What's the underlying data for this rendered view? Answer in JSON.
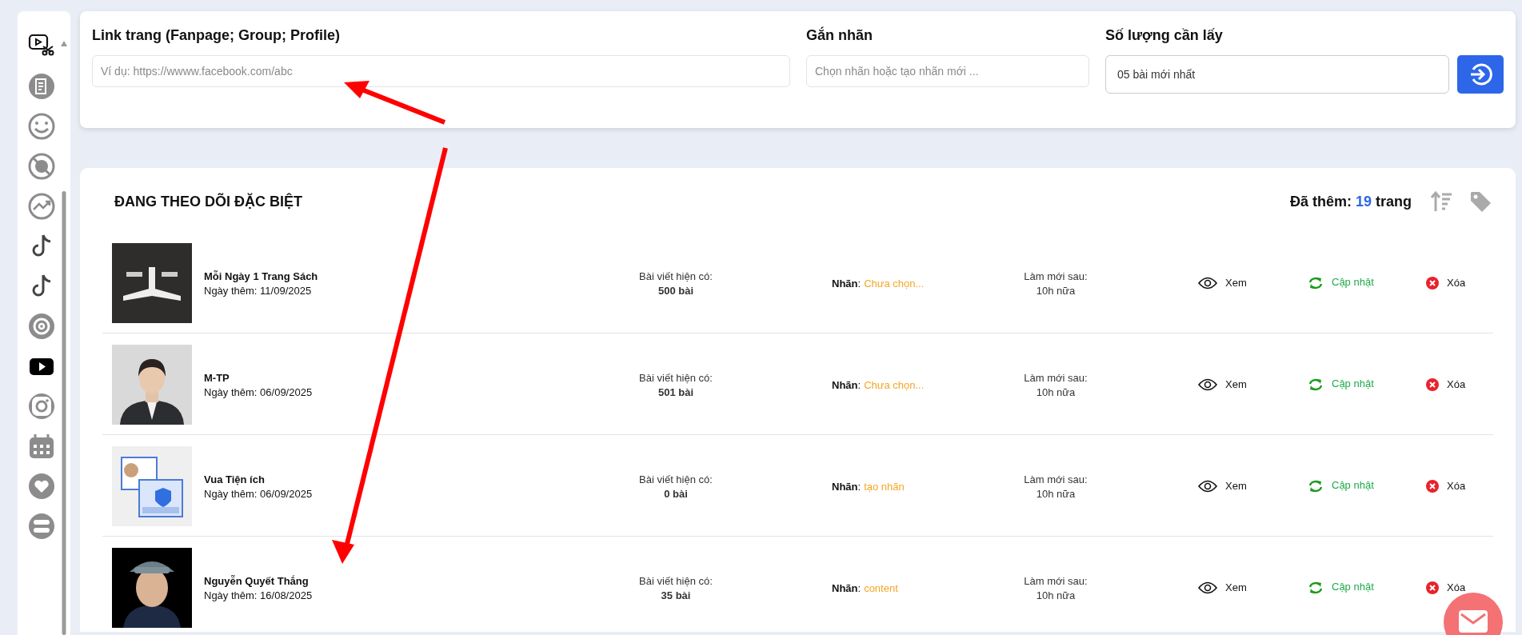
{
  "form": {
    "fields": [
      {
        "kind": "text",
        "label": "Link trang (Fanpage; Group; Profile)",
        "placeholder": "Ví dụ: https://wwww.facebook.com/abc"
      },
      {
        "kind": "text",
        "label": "Gắn nhãn",
        "placeholder": "Chọn nhãn hoặc tạo nhãn mới ..."
      },
      {
        "kind": "select",
        "label": "Số lượng cần lấy",
        "value": "05 bài mới nhất"
      }
    ]
  },
  "list": {
    "title": "ĐANG THEO DÕI ĐẶC BIỆT",
    "added_prefix": "Đã thêm:",
    "added_count": "19",
    "added_suffix": "trang",
    "rows": [
      {
        "name": "Mỗi Ngày 1 Trang Sách",
        "date": "Ngày thêm: 11/09/2025",
        "posts_label": "Bài viết hiện có:",
        "posts": "500 bài",
        "tag_label": "**Nhãn**:",
        "tag": "Chưa chọn...",
        "refresh_label": "Làm mới sau:",
        "refresh": "10h nữa",
        "view": "Xem",
        "update": "Cập nhật",
        "delete": "Xóa"
      },
      {
        "name": "M-TP",
        "date": "Ngày thêm: 06/09/2025",
        "posts_label": "Bài viết hiện có:",
        "posts": "501 bài",
        "tag_label": "**Nhãn**:",
        "tag": "Chưa chọn...",
        "refresh_label": "Làm mới sau:",
        "refresh": "10h nữa",
        "view": "Xem",
        "update": "Cập nhật",
        "delete": "Xóa"
      },
      {
        "name": "Vua Tiện ích",
        "date": "Ngày thêm: 06/09/2025",
        "posts_label": "Bài viết hiện có:",
        "posts": "0 bài",
        "tag_label": "**Nhãn**:",
        "tag": "tạo nhãn",
        "refresh_label": "Làm mới sau:",
        "refresh": "10h nữa",
        "view": "Xem",
        "update": "Cập nhật",
        "delete": "Xóa"
      },
      {
        "name": "Nguyễn Quyết Thắng",
        "date": "Ngày thêm: 16/08/2025",
        "posts_label": "Bài viết hiện có:",
        "posts": "35 bài",
        "tag_label": "**Nhãn**:",
        "tag": "content",
        "refresh_label": "Làm mới sau:",
        "refresh": "10h nữa",
        "view": "Xem",
        "update": "Cập nhật",
        "delete": "Xóa"
      }
    ]
  }
}
